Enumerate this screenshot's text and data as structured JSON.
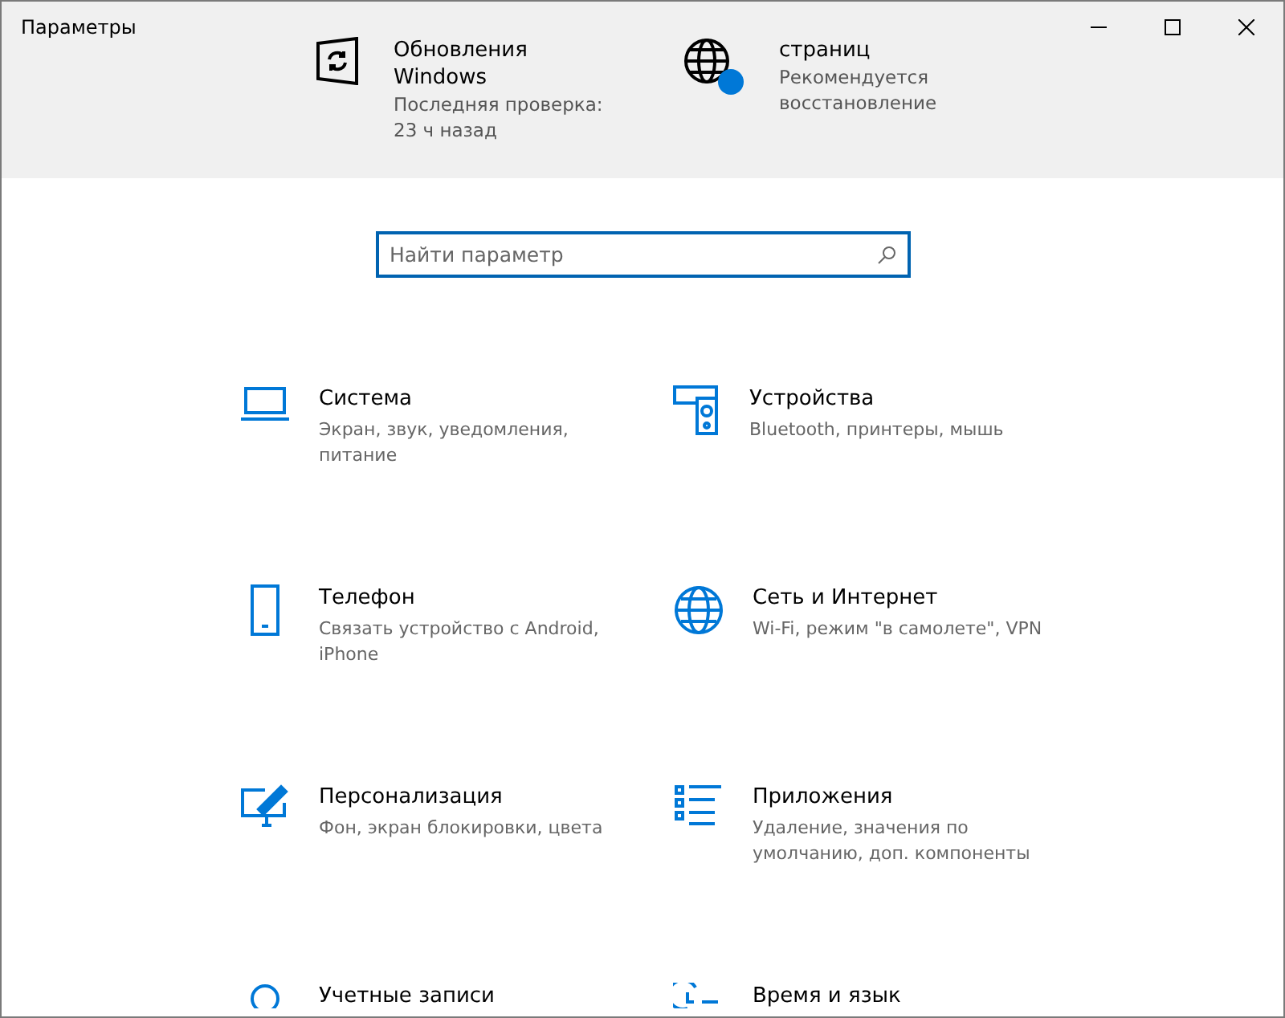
{
  "window": {
    "title": "Параметры"
  },
  "banner": [
    {
      "kind": "update",
      "title": "Обновления",
      "title2": "Windows",
      "lines": [
        "Последняя проверка:",
        "23 ч назад"
      ]
    },
    {
      "kind": "web",
      "title": "страниц",
      "lines": [
        "Рекомендуется",
        "восстановление"
      ]
    }
  ],
  "search": {
    "placeholder": "Найти параметр"
  },
  "categories": [
    {
      "kind": "system",
      "title": "Система",
      "description": "Экран, звук, уведомления, питание"
    },
    {
      "kind": "devices",
      "title": "Устройства",
      "description": "Bluetooth, принтеры, мышь"
    },
    {
      "kind": "phone",
      "title": "Телефон",
      "description": "Связать устройство с Android, iPhone"
    },
    {
      "kind": "network",
      "title": "Сеть и Интернет",
      "description": "Wi-Fi, режим \"в самолете\", VPN"
    },
    {
      "kind": "personalization",
      "title": "Персонализация",
      "description": "Фон, экран блокировки, цвета"
    },
    {
      "kind": "apps",
      "title": "Приложения",
      "description": "Удаление, значения по умолчанию, доп. компоненты"
    },
    {
      "kind": "accounts",
      "title": "Учетные записи"
    },
    {
      "kind": "time",
      "title": "Время и язык"
    }
  ]
}
